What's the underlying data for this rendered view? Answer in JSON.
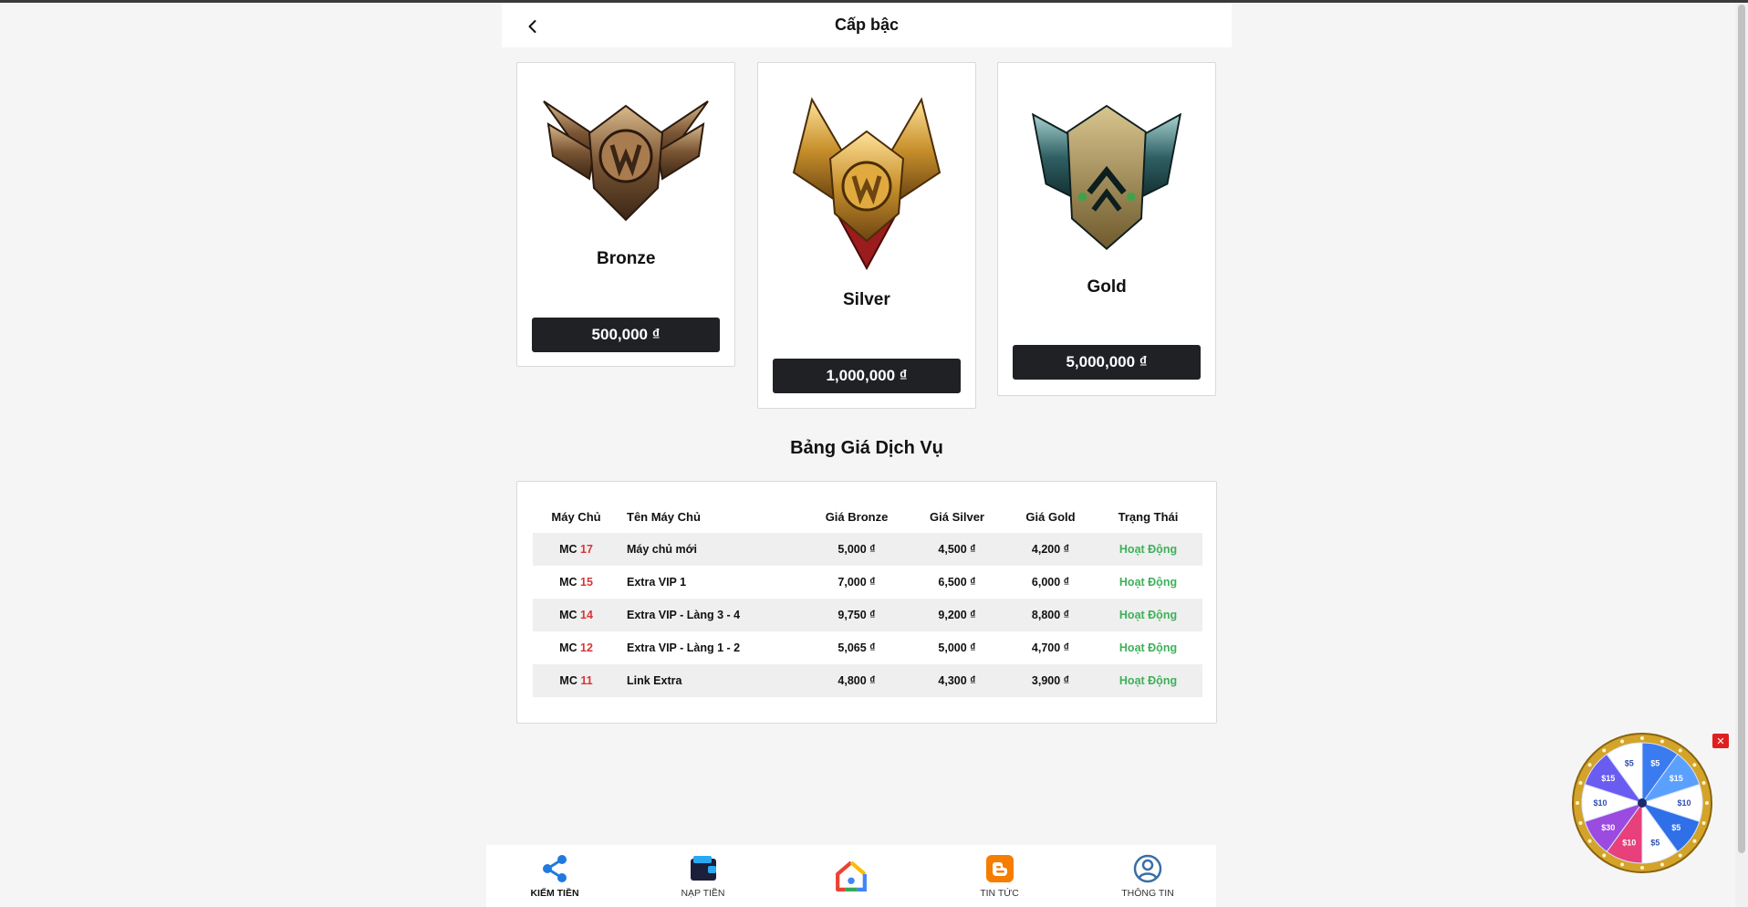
{
  "header": {
    "title": "Cấp bậc"
  },
  "ranks": [
    {
      "name": "Bronze",
      "price": "500,000 ₫"
    },
    {
      "name": "Silver",
      "price": "1,000,000 ₫"
    },
    {
      "name": "Gold",
      "price": "5,000,000 ₫"
    }
  ],
  "price_table": {
    "title": "Bảng Giá Dịch Vụ",
    "columns": [
      "Máy Chủ",
      "Tên Máy Chủ",
      "Giá Bronze",
      "Giá Silver",
      "Giá Gold",
      "Trạng Thái"
    ],
    "rows": [
      {
        "mc_prefix": "MC",
        "mc_num": "17",
        "name": "Máy chủ mới",
        "bronze": "5,000 ₫",
        "silver": "4,500 ₫",
        "gold": "4,200 ₫",
        "status": "Hoạt Động"
      },
      {
        "mc_prefix": "MC",
        "mc_num": "15",
        "name": "Extra VIP 1",
        "bronze": "7,000 ₫",
        "silver": "6,500 ₫",
        "gold": "6,000 ₫",
        "status": "Hoạt Động"
      },
      {
        "mc_prefix": "MC",
        "mc_num": "14",
        "name": "Extra VIP - Làng 3 - 4",
        "bronze": "9,750 ₫",
        "silver": "9,200 ₫",
        "gold": "8,800 ₫",
        "status": "Hoạt Động"
      },
      {
        "mc_prefix": "MC",
        "mc_num": "12",
        "name": "Extra VIP - Làng 1 - 2",
        "bronze": "5,065 ₫",
        "silver": "5,000 ₫",
        "gold": "4,700 ₫",
        "status": "Hoạt Động"
      },
      {
        "mc_prefix": "MC",
        "mc_num": "11",
        "name": "Link Extra",
        "bronze": "4,800 ₫",
        "silver": "4,300 ₫",
        "gold": "3,900 ₫",
        "status": "Hoạt Động"
      }
    ]
  },
  "bottom_nav": [
    {
      "label": "KIẾM TIỀN",
      "icon": "share-icon",
      "active": true
    },
    {
      "label": "NẠP TIỀN",
      "icon": "wallet-icon"
    },
    {
      "label": "",
      "icon": "home-icon"
    },
    {
      "label": "TIN TỨC",
      "icon": "blogger-icon"
    },
    {
      "label": "THÔNG TIN",
      "icon": "user-icon"
    }
  ],
  "wheel": {
    "segments": [
      "$5",
      "$15",
      "$10",
      "$5",
      "$5",
      "$10",
      "$30",
      "$10",
      "$15",
      "$5"
    ],
    "close_label": "✕"
  },
  "colors": {
    "accent_dark": "#1f2125",
    "status_green": "#3fb05a",
    "mc_red": "#d93636"
  }
}
